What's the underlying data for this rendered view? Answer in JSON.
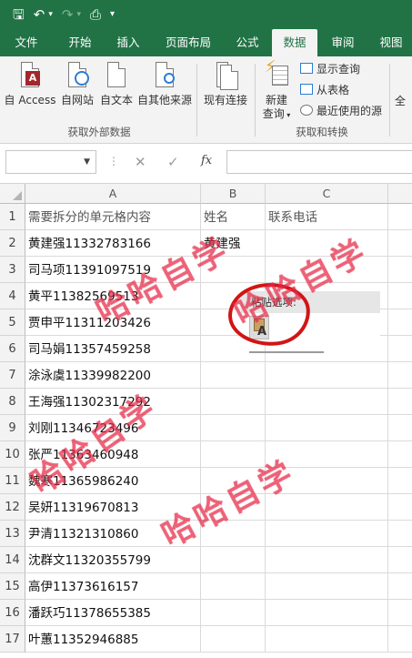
{
  "quick_access": {
    "save_icon": "save-icon",
    "undo_icon": "undo-icon",
    "redo_icon": "redo-icon",
    "print_preview_icon": "print-preview-icon",
    "customize_icon": "customize-qat-icon"
  },
  "tabs": [
    {
      "label": "文件"
    },
    {
      "label": "开始"
    },
    {
      "label": "插入"
    },
    {
      "label": "页面布局"
    },
    {
      "label": "公式"
    },
    {
      "label": "数据",
      "active": true
    },
    {
      "label": "审阅"
    },
    {
      "label": "视图"
    }
  ],
  "ribbon": {
    "get_external_data": {
      "label": "获取外部数据",
      "from_access": "自 Access",
      "from_web": "自网站",
      "from_text": "自文本",
      "from_other": "自其他来源"
    },
    "existing_connections": "现有连接",
    "get_transform": {
      "label": "获取和转换",
      "new_query_line1": "新建",
      "new_query_line2": "查询",
      "show_queries": "显示查询",
      "from_table": "从表格",
      "recent_sources": "最近使用的源"
    },
    "cut_off_button": "全"
  },
  "formula_bar": {
    "name_box": "",
    "fx": "fx",
    "formula": ""
  },
  "columns": [
    "A",
    "B",
    "C"
  ],
  "rows": [
    {
      "n": "1",
      "a": "需要拆分的单元格内容",
      "b": "姓名",
      "c": "联系电话"
    },
    {
      "n": "2",
      "a": "黄建强11332783166",
      "b": "黄建强",
      "c": ""
    },
    {
      "n": "3",
      "a": "司马项11391097519",
      "b": "",
      "c": ""
    },
    {
      "n": "4",
      "a": "黄平11382569513",
      "b": "",
      "c": ""
    },
    {
      "n": "5",
      "a": "贾申平11311203426",
      "b": "",
      "c": ""
    },
    {
      "n": "6",
      "a": "司马娟11357459258",
      "b": "",
      "c": ""
    },
    {
      "n": "7",
      "a": "涂泳虞11339982200",
      "b": "",
      "c": ""
    },
    {
      "n": "8",
      "a": "王海强11302317292",
      "b": "",
      "c": ""
    },
    {
      "n": "9",
      "a": "刘刚11346723496",
      "b": "",
      "c": ""
    },
    {
      "n": "10",
      "a": "张严11363460948",
      "b": "",
      "c": ""
    },
    {
      "n": "11",
      "a": "魏寒11365986240",
      "b": "",
      "c": ""
    },
    {
      "n": "12",
      "a": "吴妍11319670813",
      "b": "",
      "c": ""
    },
    {
      "n": "13",
      "a": "尹清11321310860",
      "b": "",
      "c": ""
    },
    {
      "n": "14",
      "a": "沈群文11320355799",
      "b": "",
      "c": ""
    },
    {
      "n": "15",
      "a": "高伊11373616157",
      "b": "",
      "c": ""
    },
    {
      "n": "16",
      "a": "潘跃巧11378655385",
      "b": "",
      "c": ""
    },
    {
      "n": "17",
      "a": "叶蕙11352946885",
      "b": "",
      "c": ""
    }
  ],
  "paste_options": {
    "title": "粘贴选项:",
    "keep_text_only_icon": "paste-keep-text-only-icon"
  },
  "watermarks": [
    "哈哈自学",
    "哈哈自学",
    "哈哈自学",
    "哈哈自学"
  ],
  "colors": {
    "excel_green": "#217346",
    "annotation_red": "#d11515",
    "watermark": "#e62846"
  }
}
